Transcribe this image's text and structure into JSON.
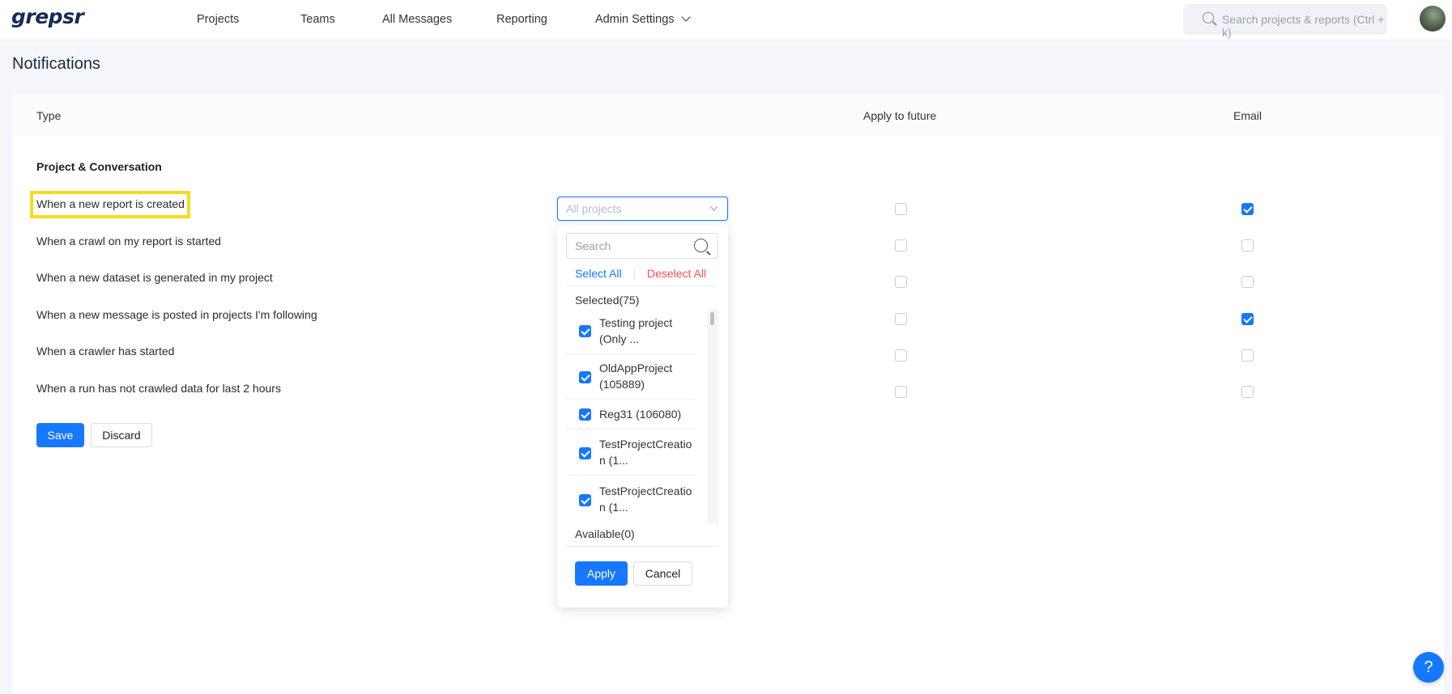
{
  "header": {
    "logo": "grepsr",
    "nav": [
      "Projects",
      "Teams",
      "All Messages",
      "Reporting",
      "Admin Settings"
    ],
    "search_placeholder": "Search projects & reports (Ctrl + k)"
  },
  "page": {
    "title": "Notifications"
  },
  "table": {
    "headers": {
      "type": "Type",
      "apply_future": "Apply to future",
      "email": "Email"
    },
    "section": "Project & Conversation",
    "rows": [
      {
        "label": "When a new report is created",
        "apply_future": false,
        "email": true
      },
      {
        "label": "When a crawl on my report is started",
        "apply_future": false,
        "email": false
      },
      {
        "label": "When a new dataset is generated in my project",
        "apply_future": false,
        "email": false
      },
      {
        "label": "When a new message is posted in projects I'm following",
        "apply_future": false,
        "email": true
      },
      {
        "label": "When a crawler has started",
        "apply_future": false,
        "email": false
      },
      {
        "label": "When a run has not crawled data for last 2 hours",
        "apply_future": false,
        "email": false
      }
    ]
  },
  "project_select": {
    "placeholder": "All projects"
  },
  "dropdown": {
    "search_placeholder": "Search",
    "select_all": "Select All",
    "deselect_all": "Deselect All",
    "selected_label": "Selected(75)",
    "available_label": "Available(0)",
    "items": [
      {
        "line1": "Testing project",
        "line2": "(Only ...",
        "checked": true
      },
      {
        "line1": "OldAppProject",
        "line2": "(105889)",
        "checked": true
      },
      {
        "line1": "Reg31 (106080)",
        "line2": "",
        "checked": true
      },
      {
        "line1": "TestProjectCreatio",
        "line2": "n (1...",
        "checked": true
      },
      {
        "line1": "TestProjectCreatio",
        "line2": "n (1...",
        "checked": true
      }
    ],
    "apply": "Apply",
    "cancel": "Cancel"
  },
  "actions": {
    "save": "Save",
    "discard": "Discard"
  },
  "help": "?",
  "colors": {
    "primary": "#1677ff",
    "danger": "#ff4d4f",
    "highlight": "#f6dd1b"
  }
}
